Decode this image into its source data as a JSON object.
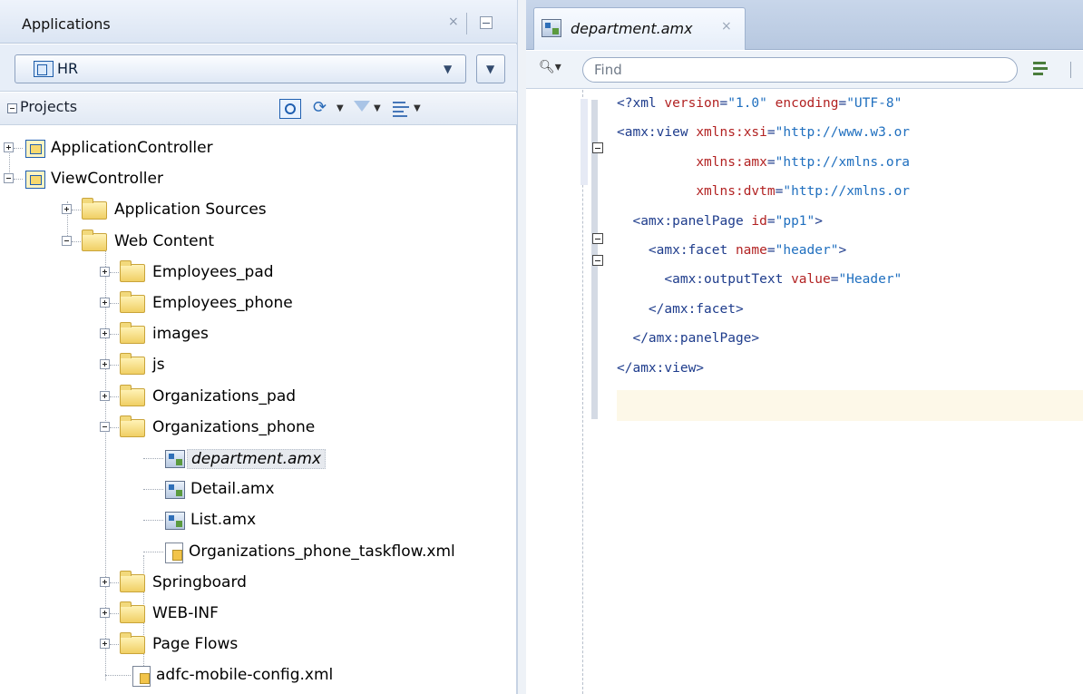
{
  "applications_panel": {
    "title": "Applications",
    "close_glyph": "×",
    "selected_application": "HR",
    "projects_label": "Projects"
  },
  "tree": [
    {
      "label": "ApplicationController",
      "icon": "project-icon",
      "expander": "plus"
    },
    {
      "label": "ViewController",
      "icon": "project-icon",
      "expander": "minus"
    },
    {
      "label": "Application Sources",
      "icon": "folder-icon",
      "expander": "plus"
    },
    {
      "label": "Web Content",
      "icon": "folder-icon",
      "expander": "minus"
    },
    {
      "label": "Employees_pad",
      "icon": "folder-icon",
      "expander": "plus"
    },
    {
      "label": "Employees_phone",
      "icon": "folder-icon",
      "expander": "plus"
    },
    {
      "label": "images",
      "icon": "folder-icon",
      "expander": "plus"
    },
    {
      "label": "js",
      "icon": "folder-icon",
      "expander": "plus"
    },
    {
      "label": "Organizations_pad",
      "icon": "folder-icon",
      "expander": "plus"
    },
    {
      "label": "Organizations_phone",
      "icon": "folder-icon",
      "expander": "minus"
    },
    {
      "label": "department.amx",
      "icon": "amx-file-icon",
      "selected": true
    },
    {
      "label": "Detail.amx",
      "icon": "amx-file-icon"
    },
    {
      "label": "List.amx",
      "icon": "amx-file-icon"
    },
    {
      "label": "Organizations_phone_taskflow.xml",
      "icon": "xml-file-icon"
    },
    {
      "label": "Springboard",
      "icon": "folder-icon",
      "expander": "plus"
    },
    {
      "label": "WEB-INF",
      "icon": "folder-icon",
      "expander": "plus"
    },
    {
      "label": "Page Flows",
      "icon": "folder-icon",
      "expander": "plus"
    },
    {
      "label": "adfc-mobile-config.xml",
      "icon": "xml-file-icon"
    }
  ],
  "editor": {
    "tab_title": "department.amx",
    "tab_close_glyph": "×",
    "find_placeholder": "Find",
    "lines": [
      [
        [
          "t-tag",
          "<?xml "
        ],
        [
          "t-attr",
          "version"
        ],
        [
          "t-tag",
          "="
        ],
        [
          "t-str",
          "\"1.0\""
        ],
        [
          "t-tag",
          " "
        ],
        [
          "t-attr",
          "encoding"
        ],
        [
          "t-tag",
          "="
        ],
        [
          "t-str",
          "\"UTF-8\""
        ]
      ],
      [
        [
          "t-tag",
          "<amx:view "
        ],
        [
          "t-attr",
          "xmlns:xsi"
        ],
        [
          "t-tag",
          "="
        ],
        [
          "t-str",
          "\"http://www.w3.or"
        ]
      ],
      [
        [
          "t-tag",
          "          "
        ],
        [
          "t-attr",
          "xmlns:amx"
        ],
        [
          "t-tag",
          "="
        ],
        [
          "t-str",
          "\"http://xmlns.ora"
        ]
      ],
      [
        [
          "t-tag",
          "          "
        ],
        [
          "t-attr",
          "xmlns:dvtm"
        ],
        [
          "t-tag",
          "="
        ],
        [
          "t-str",
          "\"http://xmlns.or"
        ]
      ],
      [
        [
          "t-tag",
          "  <amx:panelPage "
        ],
        [
          "t-attr",
          "id"
        ],
        [
          "t-tag",
          "="
        ],
        [
          "t-str",
          "\"pp1\""
        ],
        [
          "t-tag",
          ">"
        ]
      ],
      [
        [
          "t-tag",
          "    <amx:facet "
        ],
        [
          "t-attr",
          "name"
        ],
        [
          "t-tag",
          "="
        ],
        [
          "t-str",
          "\"header\""
        ],
        [
          "t-tag",
          ">"
        ]
      ],
      [
        [
          "t-tag",
          "      <amx:outputText "
        ],
        [
          "t-attr",
          "value"
        ],
        [
          "t-tag",
          "="
        ],
        [
          "t-str",
          "\"Header\""
        ]
      ],
      [
        [
          "t-tag",
          "    </amx:facet>"
        ]
      ],
      [
        [
          "t-tag",
          "  </amx:panelPage>"
        ]
      ],
      [
        [
          "t-tag",
          "</amx:view>"
        ]
      ]
    ]
  }
}
